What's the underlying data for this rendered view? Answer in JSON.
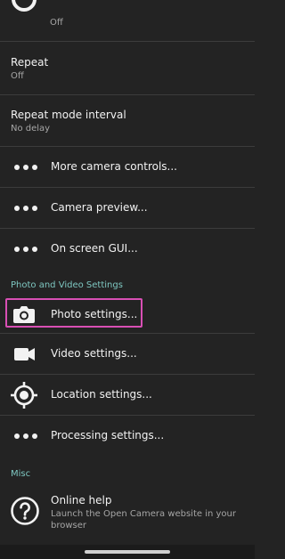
{
  "rows": {
    "top_partial": {
      "subtitle": "Off"
    },
    "repeat": {
      "title": "Repeat",
      "subtitle": "Off"
    },
    "repeat_interval": {
      "title": "Repeat mode interval",
      "subtitle": "No delay"
    },
    "more_camera": {
      "label": "More camera controls...",
      "icon": "more-dots-icon"
    },
    "camera_preview": {
      "label": "Camera preview...",
      "icon": "more-dots-icon"
    },
    "on_screen_gui": {
      "label": "On screen GUI...",
      "icon": "more-dots-icon"
    }
  },
  "sections": {
    "photo_video": {
      "title": "Photo and Video Settings"
    },
    "misc": {
      "title": "Misc"
    }
  },
  "photo_video_items": [
    {
      "label": "Photo settings...",
      "icon": "camera-icon"
    },
    {
      "label": "Video settings...",
      "icon": "video-camera-icon"
    },
    {
      "label": "Location settings...",
      "icon": "location-target-icon"
    },
    {
      "label": "Processing settings...",
      "icon": "more-dots-icon"
    }
  ],
  "misc_items": [
    {
      "title": "Online help",
      "subtitle_line1": "Launch the Open Camera website in your",
      "subtitle_line2": "browser",
      "icon": "help-circle-icon"
    }
  ],
  "colors": {
    "background": "#232323",
    "accent": "#7ec7c1",
    "highlight": "#d84fb4",
    "divider": "#3c3c3c"
  }
}
